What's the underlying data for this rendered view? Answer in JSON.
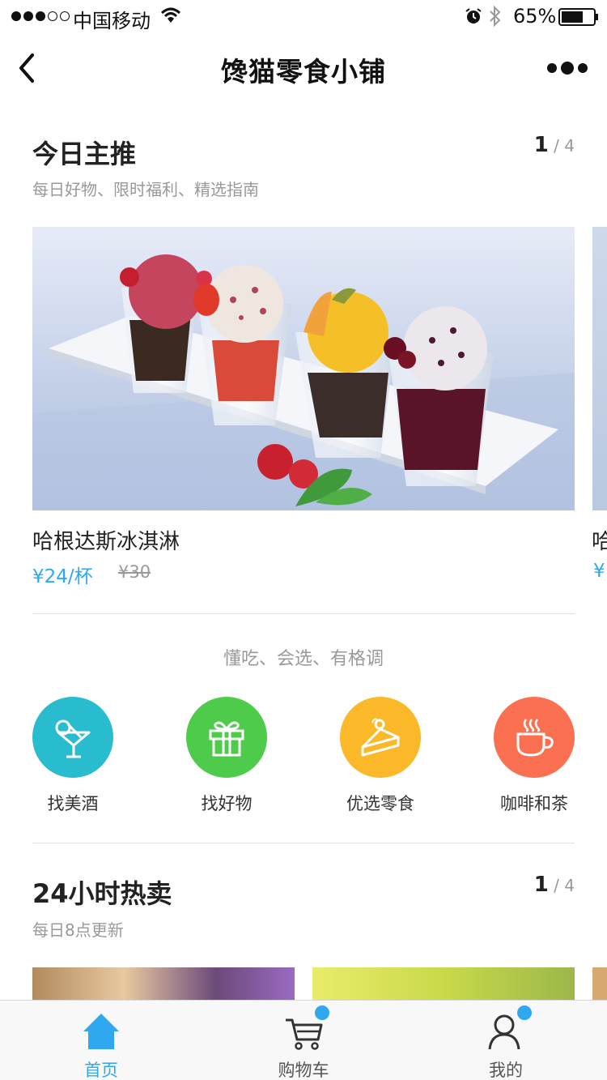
{
  "status_bar": {
    "carrier": "中国移动",
    "battery": "65%",
    "signal_strength": 3,
    "battery_level": 0.65
  },
  "nav": {
    "title": "馋猫零食小铺"
  },
  "featured": {
    "title": "今日主推",
    "subtitle": "每日好物、限时福利、精选指南",
    "pager_current": "1",
    "pager_sep": "/",
    "pager_total": "4",
    "product": {
      "name": "哈根达斯冰淇淋",
      "price": "¥24/杯",
      "original_price": "¥30"
    },
    "next_product_peek": {
      "name": "哈",
      "price": "¥"
    }
  },
  "tagline": "懂吃、会选、有格调",
  "categories": [
    {
      "label": "找美酒",
      "icon": "cocktail-icon",
      "color": "#29bccf"
    },
    {
      "label": "找好物",
      "icon": "gift-icon",
      "color": "#4ecb4a"
    },
    {
      "label": "优选零食",
      "icon": "cake-icon",
      "color": "#fbb929"
    },
    {
      "label": "咖啡和茶",
      "icon": "coffee-icon",
      "color": "#fa7050"
    }
  ],
  "hot": {
    "title": "24小时热卖",
    "subtitle": "每日8点更新",
    "pager_current": "1",
    "pager_sep": "/",
    "pager_total": "4"
  },
  "tabs": [
    {
      "label": "首页",
      "icon": "home-icon",
      "active": true,
      "badge": false
    },
    {
      "label": "购物车",
      "icon": "cart-icon",
      "active": false,
      "badge": true
    },
    {
      "label": "我的",
      "icon": "user-icon",
      "active": false,
      "badge": true
    }
  ],
  "colors": {
    "accent": "#2fa8f0",
    "text": "#222222",
    "muted": "#999999"
  }
}
